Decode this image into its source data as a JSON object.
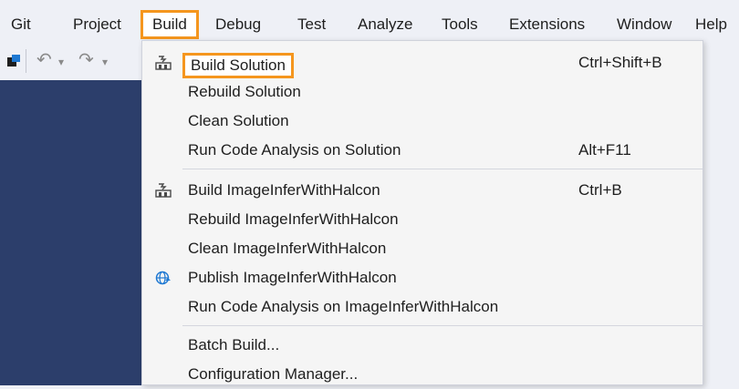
{
  "menubar": {
    "items": [
      "Git",
      "Project",
      "Build",
      "Debug",
      "Test",
      "Analyze",
      "Tools",
      "Extensions",
      "Window",
      "Help"
    ]
  },
  "toolbar": {
    "undo_glyph": "↶",
    "redo_glyph": "↷",
    "dropdown_glyph": "▾"
  },
  "build_menu": {
    "items": [
      {
        "label": "Build Solution",
        "shortcut": "Ctrl+Shift+B"
      },
      {
        "label": "Rebuild Solution",
        "shortcut": ""
      },
      {
        "label": "Clean Solution",
        "shortcut": ""
      },
      {
        "label": "Run Code Analysis on Solution",
        "shortcut": "Alt+F11"
      },
      {
        "label": "Build ImageInferWithHalcon",
        "shortcut": "Ctrl+B"
      },
      {
        "label": "Rebuild ImageInferWithHalcon",
        "shortcut": ""
      },
      {
        "label": "Clean ImageInferWithHalcon",
        "shortcut": ""
      },
      {
        "label": "Publish ImageInferWithHalcon",
        "shortcut": ""
      },
      {
        "label": "Run Code Analysis on ImageInferWithHalcon",
        "shortcut": ""
      },
      {
        "label": "Batch Build...",
        "shortcut": ""
      },
      {
        "label": "Configuration Manager...",
        "shortcut": ""
      }
    ]
  },
  "colors": {
    "highlight_border": "#f5961e",
    "editor_bg": "#2c3e6b",
    "publish_icon": "#1e78d2"
  }
}
